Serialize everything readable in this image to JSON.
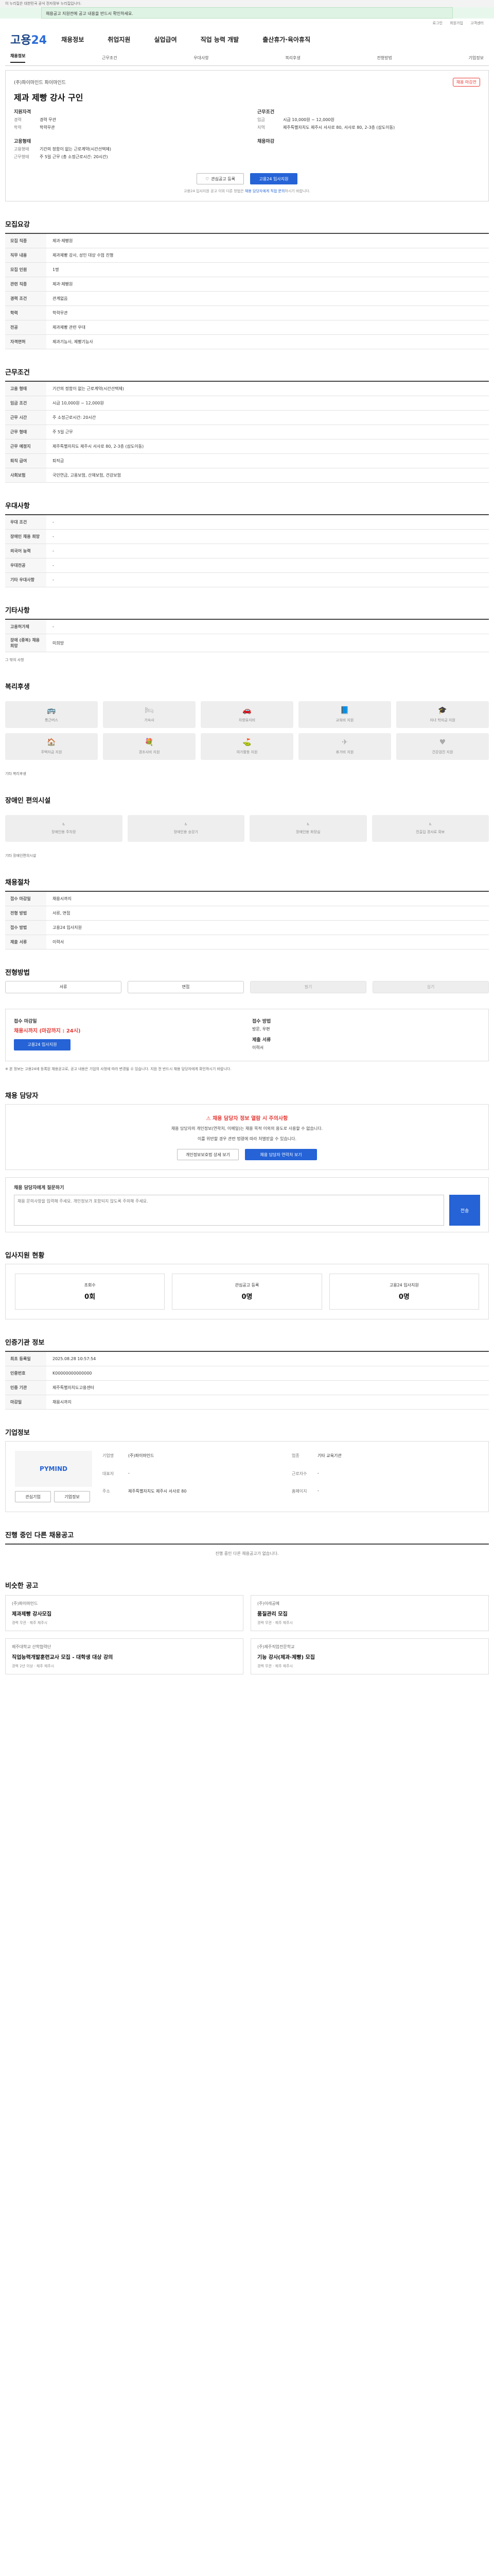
{
  "gov_banner": "이 누리집은 대한민국 공식 전자정부 누리집입니다.",
  "notice": "채용공고 지원전에 공고 내용을 반드시 확인하세요.",
  "util": [
    "로그인",
    "회원가입",
    "고객센터"
  ],
  "header": {
    "logo_a": "고용",
    "logo_b": "24",
    "gnb": [
      "채용정보",
      "취업지원",
      "실업급여",
      "직업 능력 개발",
      "출산휴가·육아휴직"
    ]
  },
  "tabs": [
    "채용정보",
    "근무조건",
    "우대사항",
    "복리후생",
    "전형방법",
    "기업정보"
  ],
  "job": {
    "company": "(주)파이마인드 파이마인드",
    "badge": "채용 마감전",
    "title": "제과 제빵 강사 구인",
    "left_head": "지원자격",
    "left": [
      [
        "경력",
        "경력 무관"
      ],
      [
        "학력",
        "학력무관"
      ]
    ],
    "left2_head": "고용형태",
    "left2": [
      [
        "고용형태",
        "기간의 정함이 없는 근로계약(시간선택제)"
      ],
      [
        "근무형태",
        "주 5일 근무 (총 소정근로시간: 20시간)"
      ]
    ],
    "right_head": "근무조건",
    "right": [
      [
        "임금",
        "시급 10,000원 ~ 12,000원"
      ],
      [
        "지역",
        "제주특별자치도 제주시 서사로 80, 서사로 80, 2-3층 (삼도이동)"
      ]
    ],
    "right2_head": "채용마감",
    "btn_interest": "관심공고 등록",
    "btn_apply": "고용24 입사지원",
    "hint_a": "고용24 입사지원 공고 이외 다른 방법은",
    "hint_b": "채용 담당자에게 직접 문의",
    "hint_c": "하시기 바랍니다."
  },
  "sections": {
    "recruit": "모집요강",
    "conditions": "근무조건",
    "preference": "우대사항",
    "etc": "기타사항",
    "welfare": "복리후생",
    "disability": "장애인 편의시설",
    "selection": "채용절차",
    "method": "전형방법",
    "manager": "채용 담당자",
    "applystatus": "입사지원 현황",
    "recommend": "인증기관 정보",
    "company": "기업정보",
    "other": "진행 중인 다른 채용공고",
    "nearby": "비슷한 공고"
  },
  "recruit_rows": [
    [
      "모집 직종",
      "제과·제빵원"
    ],
    [
      "직무 내용",
      "제과제빵 강사, 성인 대상 수업 진행"
    ],
    [
      "모집 인원",
      "1명"
    ],
    [
      "관련 직종",
      "제과·제빵원"
    ],
    [
      "경력 조건",
      "관계없음"
    ],
    [
      "학력",
      "학력무관"
    ],
    [
      "전공",
      "제과제빵 관련 우대"
    ],
    [
      "자격면허",
      "제과기능사, 제빵기능사"
    ]
  ],
  "condition_rows": [
    [
      "고용 형태",
      "기간의 정함이 없는 근로계약(시간선택제)"
    ],
    [
      "임금 조건",
      "시급 10,000원 ~ 12,000원"
    ],
    [
      "근무 시간",
      "주 소정근로시간: 20시간"
    ],
    [
      "근무 형태",
      "주 5일 근무"
    ],
    [
      "근무 예정지",
      "제주특별자치도 제주시 서사로 80, 2-3층 (삼도이동)"
    ],
    [
      "퇴직 급여",
      "퇴직금"
    ],
    [
      "사회보험",
      "국민연금, 고용보험, 산재보험, 건강보험"
    ]
  ],
  "pref_rows": [
    [
      "우대 조건",
      "-"
    ],
    [
      "장애인 채용 희망",
      "-"
    ],
    [
      "외국어 능력",
      "-"
    ],
    [
      "우대전공",
      "-"
    ],
    [
      "기타 우대사항",
      "-"
    ]
  ],
  "etc_rows": [
    [
      "고용허가제",
      "-"
    ],
    [
      "장애 (중복) 채용 희망",
      "미희망"
    ]
  ],
  "etc_note": "그 밖의 사항",
  "welfare_items": [
    "통근버스",
    "기숙사",
    "차량유지비",
    "교육비 지원",
    "자녀 학자금 지원",
    "주택자금 지원",
    "경조사비 지원",
    "여가활동 지원",
    "휴가비 지원",
    "건강검진 지원"
  ],
  "welfare_note": "기타 복리후생",
  "disability_items": [
    "장애인용 주차장",
    "장애인용 승강기",
    "장애인용 화장실",
    "진출입 경사로 확보"
  ],
  "disability_note": "기타 장애인편의시설",
  "selection_rows": [
    [
      "접수 마감일",
      "채용시까지"
    ],
    [
      "전형 방법",
      "서류, 면접"
    ],
    [
      "접수 방법",
      "고용24 입사지원"
    ],
    [
      "제출 서류",
      "이력서"
    ]
  ],
  "method_tabs": [
    "서류",
    "면접",
    "필기",
    "실기"
  ],
  "apply": {
    "lab1": "접수 마감일",
    "val1": "채용시까지 (마감까지 : 24시)",
    "lab2": "접수 방법",
    "val2": "방문, 우편",
    "lab3": "제출 서류",
    "val3": "이력서",
    "btn": "고용24 입사지원"
  },
  "apply_notes": "※ 본 정보는 고용24에 등록된 채용공고로, 공고 내용은 기업의 사정에 따라 변경될 수 있습니다. 지원 전 반드시 채용 담당자에게 확인하시기 바랍니다.",
  "manager": {
    "warn": "채용 담당자 정보 열람 시 주의사항",
    "p1": "채용 담당자의 개인정보(연락처, 이메일)는 채용 목적 이외의 용도로 사용할 수 없습니다.",
    "p2": "이를 위반할 경우 관련 법령에 따라 처벌받을 수 있습니다.",
    "btn1": "개인정보보호법 상세 보기",
    "btn2": "채용 담당자 연락처 보기",
    "qa_title": "채용 담당자에게 질문하기",
    "qa_placeholder": "채용 문의사항을 입력해 주세요. 개인정보가 포함되지 않도록 주의해 주세요.",
    "qa_send": "전송"
  },
  "stats": [
    {
      "label": "조회수",
      "value": "0회"
    },
    {
      "label": "관심공고 등록",
      "value": "0명"
    },
    {
      "label": "고용24 입사지원",
      "value": "0명"
    }
  ],
  "cert_rows": [
    [
      "최초 등록일",
      "2025.08.28 10:57:54"
    ],
    [
      "인증번호",
      "K00000000000000"
    ],
    [
      "인증 기관",
      "제주특별자치도고용센터"
    ],
    [
      "마감일",
      "채용시까지"
    ]
  ],
  "company_info": {
    "logo": "PYMIND",
    "rows": [
      [
        "기업명",
        "(주)파이마인드"
      ],
      [
        "업종",
        "기타 교육기관"
      ],
      [
        "대표자",
        "-"
      ],
      [
        "근로자수",
        "-"
      ],
      [
        "주소",
        "제주특별자치도 제주시 서사로 80"
      ],
      [
        "홈페이지",
        "-"
      ]
    ],
    "btn1": "관심기업",
    "btn2": "기업정보"
  },
  "other_empty": "진행 중인 다른 채용공고가 없습니다.",
  "nearby_cards": [
    {
      "company": "(주)파이마인드",
      "title": "제과제빵 강사모집",
      "meta": "경력 무관 · 제주 제주시"
    },
    {
      "company": "(주)이레공예",
      "title": "품질관리 모집",
      "meta": "경력 무관 · 제주 제주시"
    },
    {
      "company": "제주대학교 산학협력단",
      "title": "직업능력개발훈련교사 모집 - 대학생 대상 강의",
      "meta": "경력 2년 이상 · 제주 제주시"
    },
    {
      "company": "(주)제주직업전문학교",
      "title": "기능 강사(제과·제빵) 모집",
      "meta": "경력 무관 · 제주 제주시"
    }
  ]
}
